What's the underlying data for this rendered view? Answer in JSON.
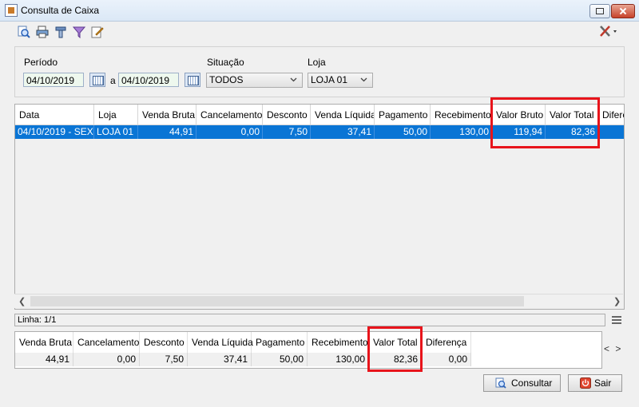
{
  "window": {
    "title": "Consulta de Caixa"
  },
  "filters": {
    "periodo_label": "Período",
    "date_from": "04/10/2019",
    "a_label": "a",
    "date_to": "04/10/2019",
    "situacao_label": "Situação",
    "situacao_value": "TODOS",
    "loja_label": "Loja",
    "loja_value": "LOJA 01"
  },
  "grid": {
    "columns": [
      "Data",
      "Loja",
      "Venda Bruta",
      "Cancelamento",
      "Desconto",
      "Venda Líquida",
      "Pagamento",
      "Recebimento",
      "Valor Bruto",
      "Valor Total",
      "Diferença"
    ],
    "rows": [
      [
        "04/10/2019 - SEX",
        "LOJA 01",
        "44,91",
        "0,00",
        "7,50",
        "37,41",
        "50,00",
        "130,00",
        "119,94",
        "82,36",
        ""
      ]
    ]
  },
  "status": {
    "linha": "Linha: 1/1"
  },
  "totals": {
    "columns": [
      "Venda Bruta",
      "Cancelamento",
      "Desconto",
      "Venda Líquida",
      "Pagamento",
      "Recebimento",
      "Valor Total",
      "Diferença"
    ],
    "values": [
      "44,91",
      "0,00",
      "7,50",
      "37,41",
      "50,00",
      "130,00",
      "82,36",
      "0,00"
    ],
    "nav": "< >"
  },
  "buttons": {
    "consultar": "Consultar",
    "sair": "Sair"
  },
  "colors": {
    "selection": "#0a75d5",
    "highlight": "#e8141b"
  },
  "icons": [
    "search-report-icon",
    "print-icon",
    "tools-icon",
    "filter-icon",
    "edit-icon",
    "settings-tools-icon",
    "calendar-icon",
    "consultar-icon",
    "power-icon"
  ]
}
